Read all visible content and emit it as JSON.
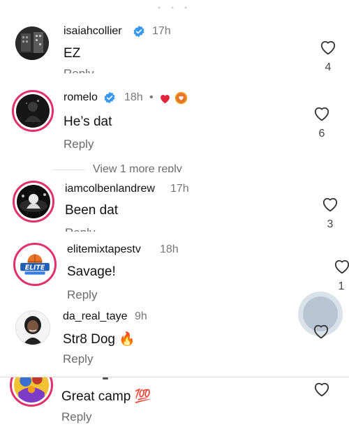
{
  "comments": [
    {
      "username": "isaiahcollier",
      "time": "17h",
      "text": "EZ",
      "reply_label": "Reply",
      "likes": "4",
      "verified": true
    },
    {
      "username": "romelo",
      "time": "18h",
      "separator": "•",
      "text": "He’s dat",
      "reply_label": "Reply",
      "likes": "6",
      "verified": true,
      "reaction_icons": [
        "red-heart-icon",
        "creator-liked-icon"
      ]
    },
    {
      "view_more_label": "View 1 more reply"
    },
    {
      "username": "iamcolbenlandrew",
      "time": "17h",
      "text": "Been dat",
      "reply_label": "Reply",
      "likes": "3"
    },
    {
      "username": "elitemixtapestv",
      "time": "18h",
      "text": "Savage!",
      "reply_label": "Reply",
      "likes": "1",
      "avatar_text": "ELITE"
    },
    {
      "username": "da_real_taye",
      "time": "9h",
      "text": "Str8 Dog 🔥",
      "reply_label": "Reply"
    },
    {
      "text": "Great camp 💯",
      "reply_label": "Reply"
    }
  ],
  "colors": {
    "verified_blue": "#3897f0",
    "story_ring": "#e1306c",
    "muted_text": "#6b6b6b"
  }
}
